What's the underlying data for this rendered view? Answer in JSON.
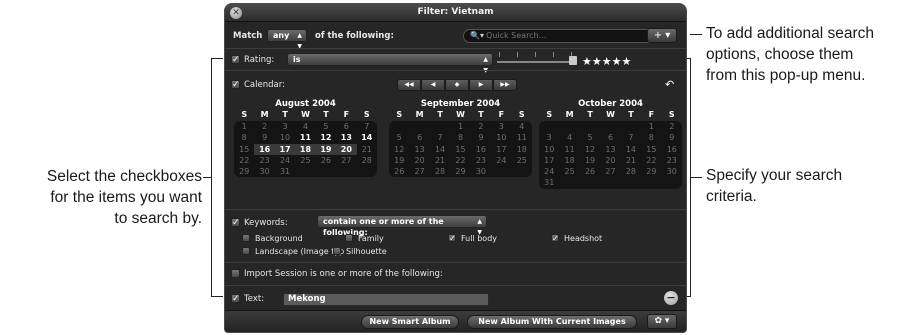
{
  "annotations": {
    "add_options": [
      "To add additional search",
      "options, choose them",
      "from this pop-up menu."
    ],
    "specify": [
      "Specify your search",
      "criteria."
    ],
    "checkboxes": [
      "Select the checkboxes",
      "for the items you want",
      "to search by."
    ]
  },
  "window": {
    "title": "Filter: Vietnam"
  },
  "match": {
    "prefix": "Match",
    "value": "any",
    "suffix": "of the following:"
  },
  "search": {
    "placeholder": "Quick Search..."
  },
  "add_button": {
    "label": "+ ▾"
  },
  "rating": {
    "label": "Rating:",
    "operator": "is",
    "stars": "★★★★★",
    "value": 5,
    "max": 5
  },
  "calendar": {
    "label": "Calendar:",
    "nav": [
      "◀◀",
      "◀",
      "◆",
      "▶",
      "▶▶"
    ],
    "undo_icon": "↶",
    "months": [
      {
        "title": "August 2004",
        "dows": [
          "S",
          "M",
          "T",
          "W",
          "T",
          "F",
          "S"
        ],
        "weeks": [
          [
            "1",
            "2",
            "3",
            "4",
            "5",
            "6",
            "7"
          ],
          [
            "8",
            "9",
            "10",
            "11",
            "12",
            "13",
            "14"
          ],
          [
            "15",
            "16",
            "17",
            "18",
            "19",
            "20",
            "21"
          ],
          [
            "22",
            "23",
            "24",
            "25",
            "26",
            "27",
            "28"
          ],
          [
            "29",
            "30",
            "31",
            "",
            "",
            "",
            ""
          ]
        ],
        "highlighted": [
          "11",
          "12",
          "13",
          "14",
          "16",
          "17",
          "18",
          "19",
          "20"
        ],
        "selected": [
          "16",
          "17",
          "18",
          "19",
          "20"
        ]
      },
      {
        "title": "September 2004",
        "dows": [
          "S",
          "M",
          "T",
          "W",
          "T",
          "F",
          "S"
        ],
        "weeks": [
          [
            "",
            "",
            "",
            "1",
            "2",
            "3",
            "4"
          ],
          [
            "5",
            "6",
            "7",
            "8",
            "9",
            "10",
            "11"
          ],
          [
            "12",
            "13",
            "14",
            "15",
            "16",
            "17",
            "18"
          ],
          [
            "19",
            "20",
            "21",
            "22",
            "23",
            "24",
            "25"
          ],
          [
            "26",
            "27",
            "28",
            "29",
            "30",
            "",
            ""
          ]
        ],
        "highlighted": [],
        "selected": []
      },
      {
        "title": "October 2004",
        "dows": [
          "S",
          "M",
          "T",
          "W",
          "T",
          "F",
          "S"
        ],
        "weeks": [
          [
            "",
            "",
            "",
            "",
            "",
            "1",
            "2"
          ],
          [
            "3",
            "4",
            "5",
            "6",
            "7",
            "8",
            "9"
          ],
          [
            "10",
            "11",
            "12",
            "13",
            "14",
            "15",
            "16"
          ],
          [
            "17",
            "18",
            "19",
            "20",
            "21",
            "22",
            "23"
          ],
          [
            "24",
            "25",
            "26",
            "27",
            "28",
            "29",
            "30"
          ],
          [
            "31",
            "",
            "",
            "",
            "",
            "",
            ""
          ]
        ],
        "highlighted": [],
        "selected": []
      }
    ]
  },
  "keywords": {
    "label": "Keywords:",
    "operator": "contain one or more of the following:",
    "options": [
      {
        "label": "Background",
        "checked": false
      },
      {
        "label": "Family",
        "checked": false
      },
      {
        "label": "Full body",
        "checked": true
      },
      {
        "label": "Headshot",
        "checked": true
      },
      {
        "label": "Landscape (Image typ",
        "checked": false
      },
      {
        "label": "Silhouette",
        "checked": false
      }
    ]
  },
  "import_session": {
    "label": "Import Session is one or more of the following:"
  },
  "text": {
    "label": "Text:",
    "value": "Mekong"
  },
  "bottom": {
    "new_smart_album": "New Smart Album",
    "new_album_current": "New Album With Current Images",
    "gear": "✿ ▾"
  }
}
